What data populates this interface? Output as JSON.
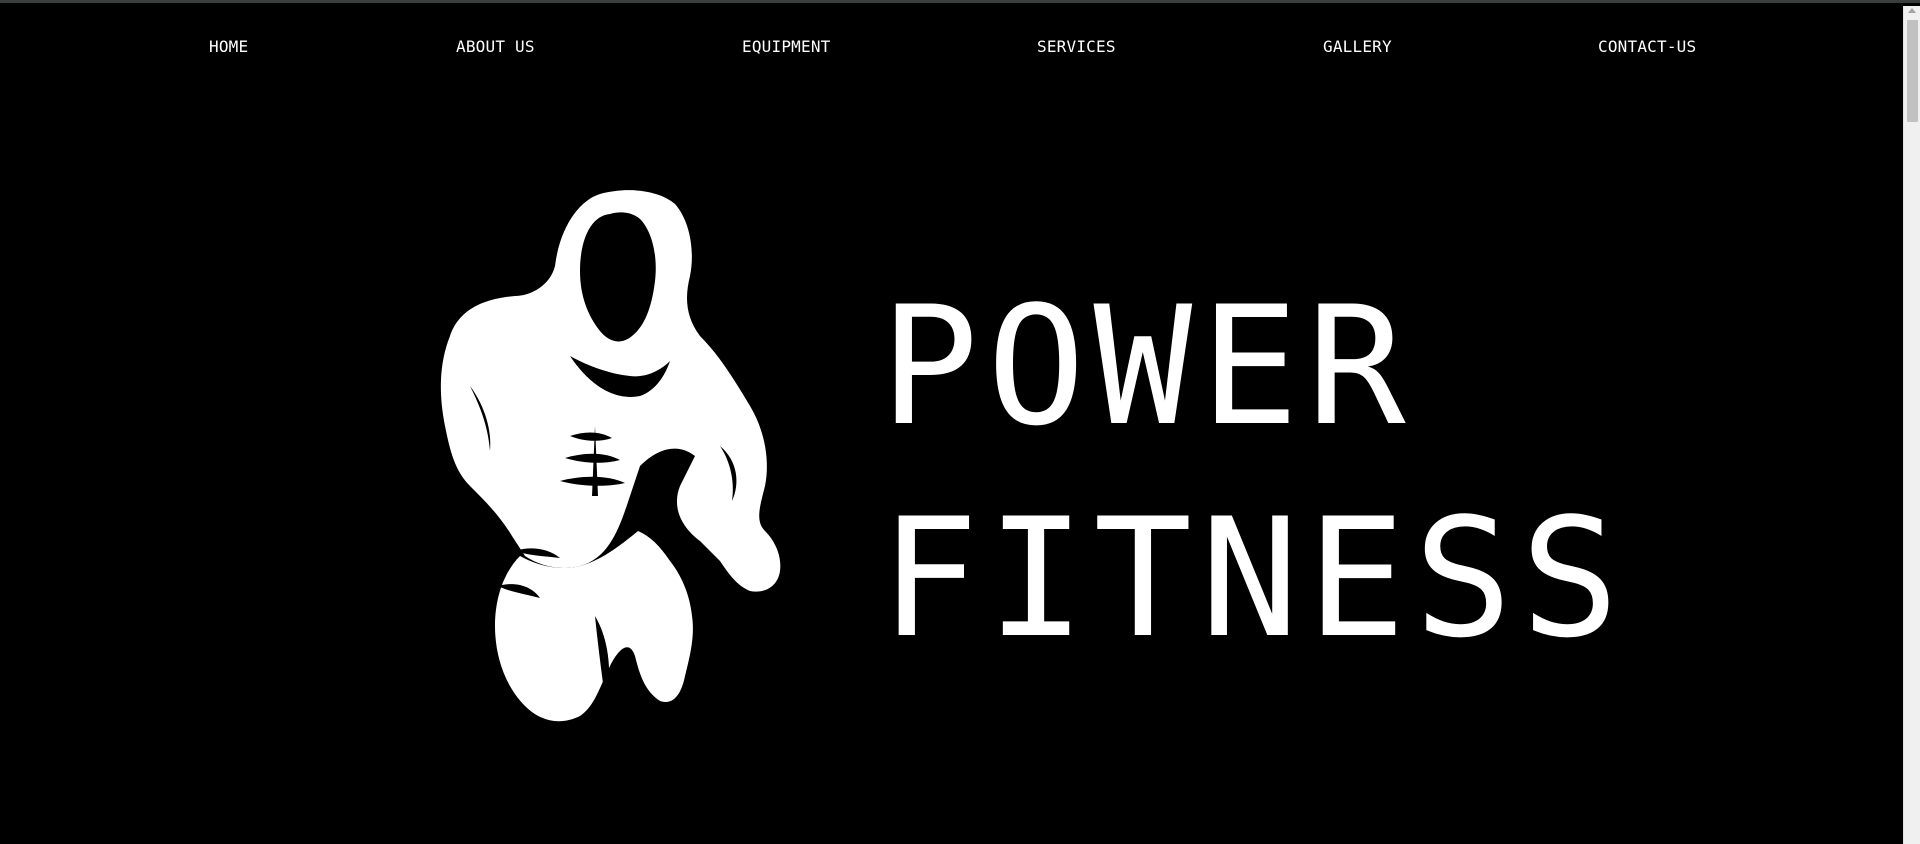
{
  "nav": {
    "items": [
      {
        "label": "HOME"
      },
      {
        "label": "ABOUT US"
      },
      {
        "label": "EQUIPMENT"
      },
      {
        "label": "SERVICES"
      },
      {
        "label": "GALLERY"
      },
      {
        "label": "CONTACT-US"
      }
    ]
  },
  "hero": {
    "title_line1": "POWER",
    "title_line2": "FITNESS",
    "logo_icon": "bodybuilder-silhouette-icon"
  },
  "colors": {
    "background": "#000000",
    "text": "#ffffff"
  }
}
